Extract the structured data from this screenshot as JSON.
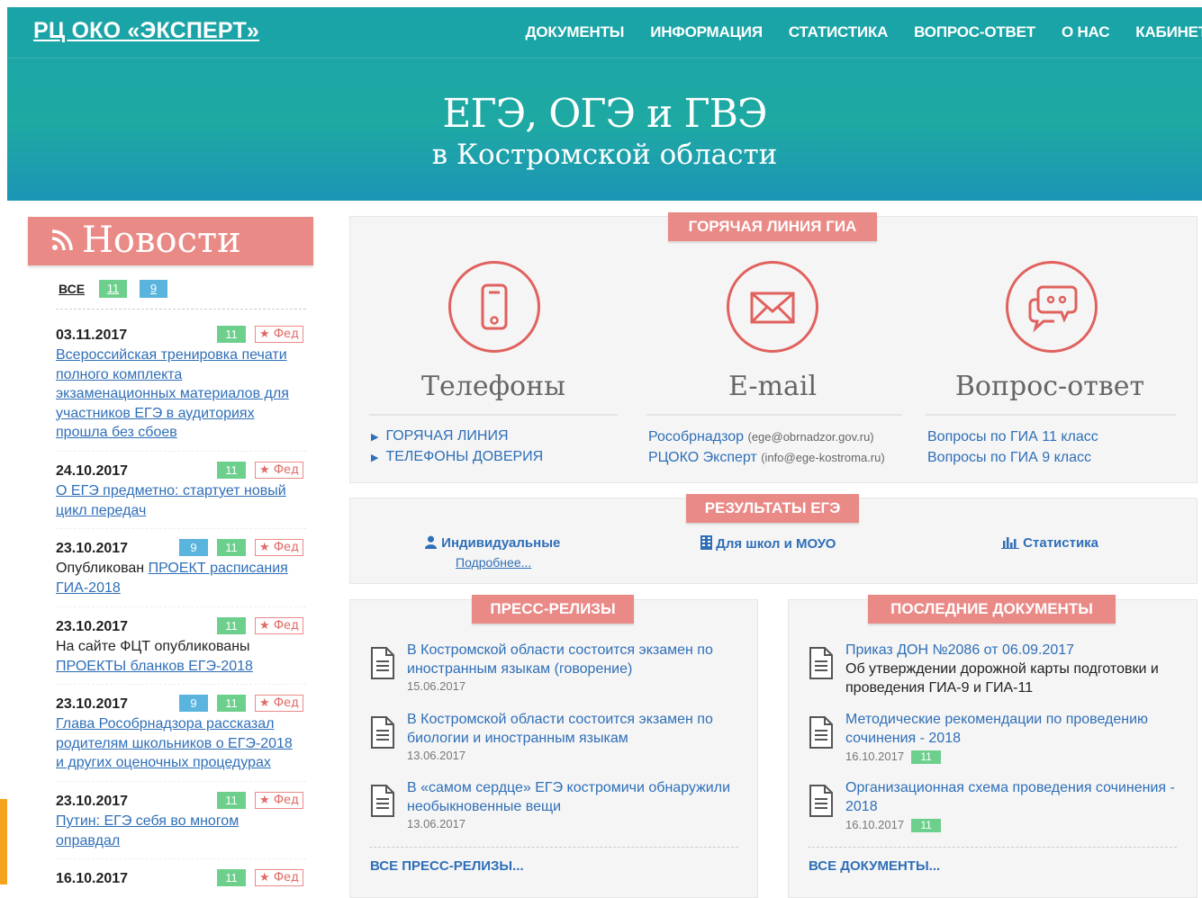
{
  "header": {
    "brand": "РЦ ОКО «ЭКСПЕРТ»",
    "nav": [
      "ДОКУМЕНТЫ",
      "ИНФОРМАЦИЯ",
      "СТАТИСТИКА",
      "ВОПРОС-ОТВЕТ",
      "О НАС",
      "КАБИНЕТ"
    ],
    "hero_title": "ЕГЭ, ОГЭ и ГВЭ",
    "hero_subtitle": "в Костромской области"
  },
  "news": {
    "title": "Новости",
    "filters": {
      "all": "ВСЕ",
      "g11": "11",
      "g9": "9"
    },
    "fed_label": "★ Фед",
    "items": [
      {
        "date": "03.11.2017",
        "tags": [
          "11"
        ],
        "pre": "",
        "link": "Всероссийская тренировка печати полного комплекта экзаменационных материалов для участников ЕГЭ в аудиториях прошла без сбоев",
        "post": ""
      },
      {
        "date": "24.10.2017",
        "tags": [
          "11"
        ],
        "pre": "",
        "link": "О ЕГЭ предметно: стартует новый цикл передач",
        "post": ""
      },
      {
        "date": "23.10.2017",
        "tags": [
          "9",
          "11"
        ],
        "pre": "Опубликован ",
        "link": "ПРОЕКТ расписания ГИА-2018",
        "post": ""
      },
      {
        "date": "23.10.2017",
        "tags": [
          "11"
        ],
        "pre": "На сайте ФЦТ опубликованы ",
        "link": "ПРОЕКТЫ бланков ЕГЭ-2018",
        "post": ""
      },
      {
        "date": "23.10.2017",
        "tags": [
          "9",
          "11"
        ],
        "pre": "",
        "link": "Глава Рособрнадзора рассказал родителям школьников о ЕГЭ-2018 и других оценочных процедурах",
        "post": ""
      },
      {
        "date": "23.10.2017",
        "tags": [
          "11"
        ],
        "pre": "",
        "link": "Путин: ЕГЭ себя во многом оправдал",
        "post": ""
      },
      {
        "date": "16.10.2017",
        "tags": [
          "11"
        ],
        "pre": "",
        "link": "",
        "post": ""
      }
    ]
  },
  "hotline": {
    "title": "ГОРЯЧАЯ ЛИНИЯ ГИА",
    "phones": {
      "title": "Телефоны",
      "links": [
        "ГОРЯЧАЯ ЛИНИЯ",
        "ТЕЛЕФОНЫ ДОВЕРИЯ"
      ]
    },
    "email": {
      "title": "E-mail",
      "links": [
        {
          "name": "Рособрнадзор",
          "addr": "(ege@obrnadzor.gov.ru)"
        },
        {
          "name": "РЦОКО Эксперт",
          "addr": "(info@ege-kostroma.ru)"
        }
      ]
    },
    "qa": {
      "title": "Вопрос-ответ",
      "links": [
        "Вопросы по ГИА 11 класс",
        "Вопросы по ГИА 9 класс"
      ]
    }
  },
  "results": {
    "title": "РЕЗУЛЬТАТЫ ЕГЭ",
    "individual": "Индивидуальные",
    "more": "Подробнее...",
    "schools": "Для школ и МОУО",
    "stats": "Статистика"
  },
  "press": {
    "title": "ПРЕСС-РЕЛИЗЫ",
    "items": [
      {
        "text": "В Костромской области состоится экзамен по иностранным языкам (говорение)",
        "date": "15.06.2017"
      },
      {
        "text": "В Костромской области состоится экзамен по биологии и иностранным языкам",
        "date": "13.06.2017"
      },
      {
        "text": "В «самом сердце» ЕГЭ костромичи обнаружили необыкновенные вещи",
        "date": "13.06.2017"
      }
    ],
    "all": "ВСЕ ПРЕСС-РЕЛИЗЫ..."
  },
  "docs": {
    "title": "ПОСЛЕДНИЕ ДОКУМЕНТЫ",
    "items": [
      {
        "link": "Приказ ДОН №2086 от 06.09.2017",
        "desc": "Об утверждении дорожной карты подготовки и проведения ГИА-9 и ГИА-11",
        "date": "",
        "grade": ""
      },
      {
        "link": "Методические рекомендации по проведению сочинения - 2018",
        "desc": "",
        "date": "16.10.2017",
        "grade": "11"
      },
      {
        "link": "Организационная схема проведения сочинения - 2018",
        "desc": "",
        "date": "16.10.2017",
        "grade": "11"
      }
    ],
    "all": "ВСЕ ДОКУМЕНТЫ..."
  },
  "colors": {
    "teal": "#1fa7a6",
    "salmon": "#e98a87",
    "icon_red": "#e0615d",
    "green": "#6dcf8c",
    "blue": "#5ab4de",
    "link": "#2f6fb8"
  }
}
